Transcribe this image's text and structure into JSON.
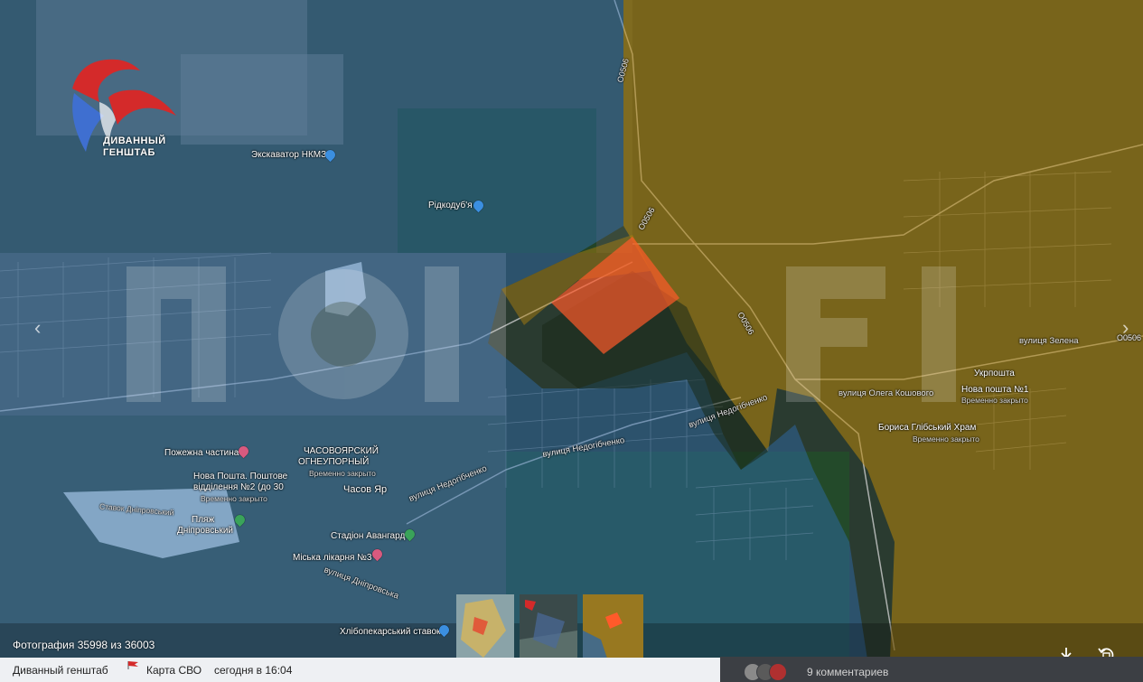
{
  "watermark": {
    "brand_line1": "ДИВАННЫЙ",
    "brand_line2": "ГЕНШТАБ"
  },
  "map_labels": {
    "excavator": "Экскаватор НКМЗ",
    "ridkodub": "Рідкодуб'я",
    "road_north": "O0506",
    "road_center": "O0506",
    "road_mid": "O0506",
    "road_east": "O0506",
    "street_zelena": "вулиця Зелена",
    "ukrposhta": "Укрпошта",
    "nova_poshta_1": "Нова пошта №1",
    "nova_poshta_1_sub": "Временно закрыто",
    "street_koshovoho": "вулиця Олега Кошового",
    "boris_temple": "Бориса Глібський Храм",
    "boris_temple_sub": "Временно закрыто",
    "street_nedohibchenko_1": "вулиця Недогібченко",
    "street_nedohibchenko_2": "вулиця Недогібченко",
    "street_nedohibchenko_3": "вулиця Недогібченко",
    "fire_station": "Пожежна частина",
    "refractory_1": "ЧАСОВОЯРСКИЙ",
    "refractory_2": "ОГНЕУПОРНЫЙ",
    "refractory_sub": "Временно закрыто",
    "nova_poshta_branch_1": "Нова Пошта. Поштове",
    "nova_poshta_branch_2": "відділення №2 (до 30",
    "nova_poshta_branch_sub": "Временно закрыто",
    "chasiv_yar": "Часов Яр",
    "beach_1": "Пляж",
    "beach_2": "Дніпровський",
    "stadium": "Стадіон Авангард",
    "hospital": "Міська лікарня №3",
    "street_dniprovska": "вулиця Дніпровська",
    "pond_label": "Ставок Дніпровський",
    "bakery_pond": "Хлібопекарський ставок"
  },
  "viewer": {
    "photo_counter": "Фотография 35998 из 36003",
    "download_icon": "download-icon",
    "rotate_icon": "rotate-icon",
    "prev_icon": "chevron-left-icon",
    "next_icon": "chevron-right-icon"
  },
  "bottom_bar": {
    "channel": "Диванный генштаб",
    "album": "Карта СВО",
    "time": "сегодня в 16:04",
    "comments": "9 комментариев"
  },
  "colors": {
    "russian_zone": "#b8860b",
    "ukrainian_zone": "#2f6fb5",
    "contested_zone": "#ff5a2a",
    "accent_red": "#d42a2a"
  }
}
